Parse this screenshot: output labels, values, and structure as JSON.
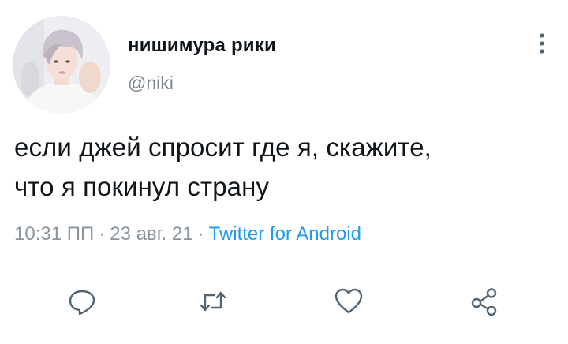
{
  "user": {
    "display_name": "нишимура рики",
    "handle": "@niki"
  },
  "tweet": {
    "line1": "если джей спросит где я, скажите,",
    "line2": "что я покинул страну"
  },
  "meta": {
    "time": "10:31 ПП",
    "separator": "·",
    "date": "23 авг. 21",
    "source": "Twitter for Android"
  },
  "icons": {
    "more": "more-vertical-icon",
    "reply": "reply-icon",
    "retweet": "retweet-icon",
    "like": "like-icon",
    "share": "share-icon"
  },
  "colors": {
    "text": "#0f1419",
    "secondary": "#8a949c",
    "link": "#1d9bf0",
    "icon": "#536471",
    "divider": "#e3e6e9"
  }
}
